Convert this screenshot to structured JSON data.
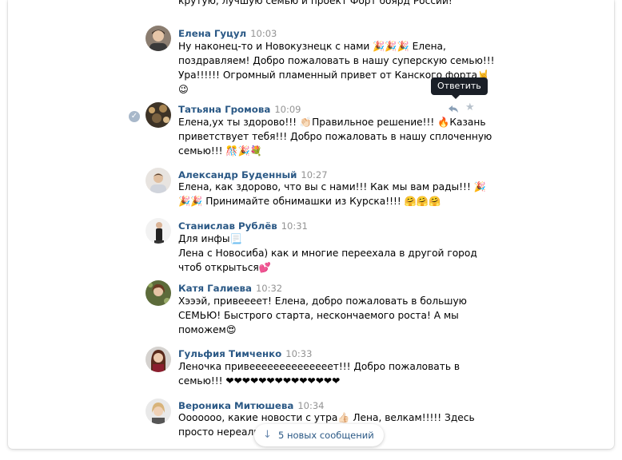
{
  "top_partial_text": "крутую, лучшую семью и проект Форт боярд России!",
  "tooltip": "Ответить",
  "new_messages_label": "5 новых сообщений",
  "messages": [
    {
      "author": "Елена Гуцул",
      "time": "10:03",
      "lines": [
        "Ну наконец-то и Новокузнецк с нами 🎉🎉🎉 Елена,",
        "поздравляем! Добро пожаловать в нашу суперскую семью!!!",
        "Ура!!!!!! Огромный пламенный привет от Канского форта🤘",
        "😉"
      ]
    },
    {
      "author": "Татьяна Громова",
      "time": "10:09",
      "lines": [
        "Елена,ух ты здорово!!! 👏🏻Правильное решение!!! 🔥Казань",
        "приветствует тебя!!! Добро пожаловать в нашу сплоченную",
        "семью!!! 🎊🎉💐"
      ]
    },
    {
      "author": "Александр Буденный",
      "time": "10:27",
      "lines": [
        "Елена, как здорово, что вы с нами!!! Как мы вам рады!!! 🎉",
        "🎉🎉 Принимайте обнимашки из Курска!!!! 🤗🤗🤗"
      ]
    },
    {
      "author": "Станислав Рублёв",
      "time": "10:31",
      "lines": [
        "Для инфы📃",
        "Лена с Новосиба) как и многие переехала в другой город",
        "чтоб открыться💕"
      ]
    },
    {
      "author": "Катя Галиева",
      "time": "10:32",
      "lines": [
        "Хэээй, привеееет! Елена, добро пожаловать в большую",
        "СЕМЬЮ! Быстрого старта, нескончаемого роста! А мы",
        "поможем😍"
      ]
    },
    {
      "author": "Гульфия Тимченко",
      "time": "10:33",
      "lines": [
        "Леночка привеееееееееееееет!!! Добро пожаловать в",
        "семью!!! ❤❤❤❤❤❤❤❤❤❤❤❤❤❤"
      ]
    },
    {
      "author": "Вероника Митюшева",
      "time": "10:34",
      "lines": [
        "Ооооооо, какие новости с утра👍🏻 Лена, велкам!!!!! Здесь",
        "просто нереально"
      ]
    }
  ],
  "colors": {
    "author": "#2a5885",
    "time": "#939393",
    "tooltip_bg": "#1a1f27",
    "check_bg": "#a8b8ca"
  },
  "icons": [
    "reply-icon",
    "star-icon",
    "check-icon",
    "arrow-down-icon"
  ]
}
